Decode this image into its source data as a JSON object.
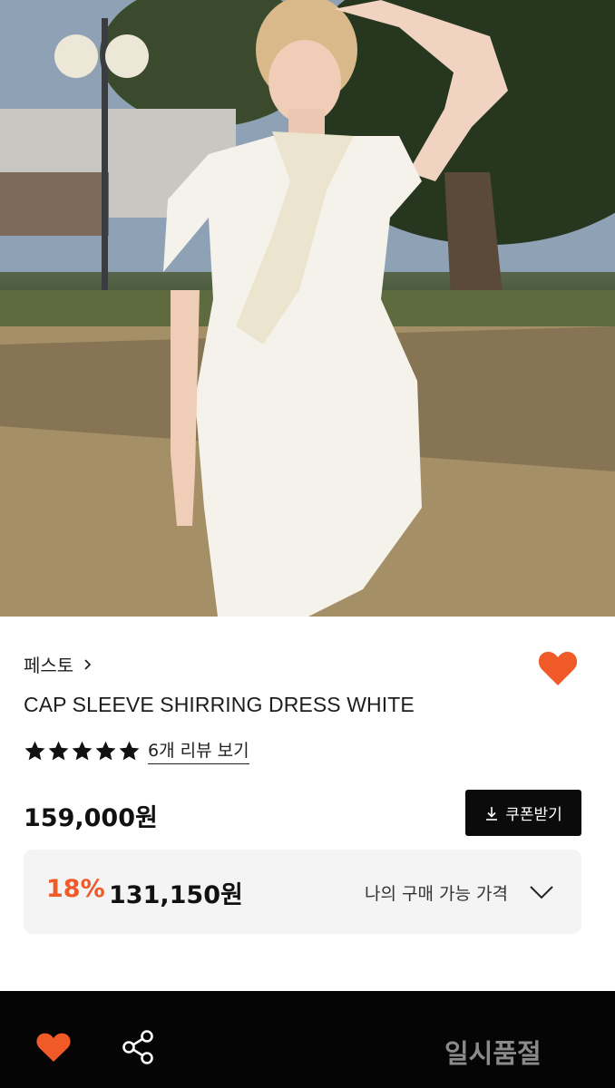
{
  "product": {
    "brand": "페스토",
    "title": "CAP SLEEVE SHIRRING DRESS WHITE",
    "rating_stars": 5,
    "review_link": "6개 리뷰 보기",
    "price": "159,000원",
    "coupon_label": "쿠폰받기",
    "discount_rate": "18%",
    "sale_price": "131,150원",
    "my_price_label": "나의 구매 가능 가격"
  },
  "bottom_bar": {
    "status": "일시품절"
  },
  "icons": {
    "favorite": "heart-icon",
    "brand_arrow": "chevron-right-icon",
    "star": "star-icon",
    "coupon": "download-icon",
    "expand": "chevron-down-icon",
    "share": "share-icon"
  },
  "colors": {
    "accent": "#f05a28",
    "bottom_bar": "#050505",
    "soldout_text": "#8a8a8a",
    "discount_box": "#f4f4f4"
  }
}
